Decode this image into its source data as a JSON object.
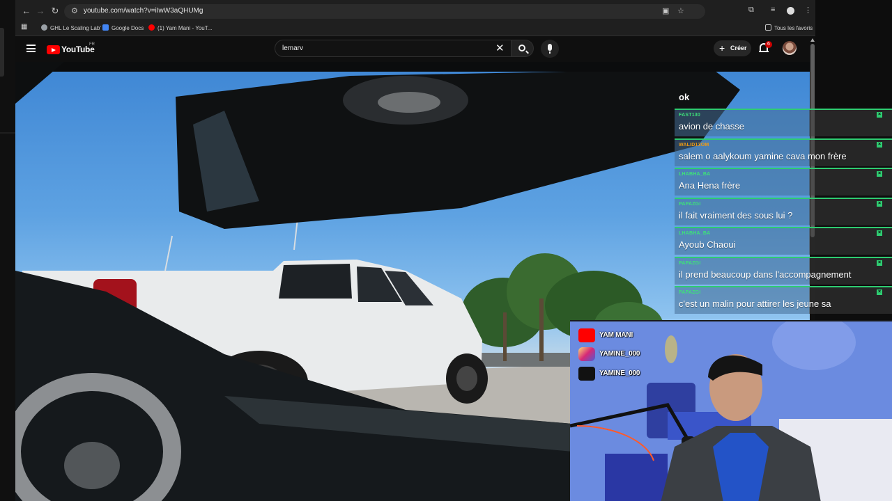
{
  "browser": {
    "url": "youtube.com/watch?v=iIwW3aQHUMg",
    "bookmarks": [
      {
        "label": "GHL Le Scaling Lab'",
        "icon": "globe-icon"
      },
      {
        "label": "Google Docs",
        "icon": "docs-icon"
      },
      {
        "label": "(1) Yam Mani - YouT...",
        "icon": "youtube-icon"
      }
    ],
    "bookmarks_folder": "Tous les favoris"
  },
  "youtube": {
    "logo_text": "YouTube",
    "region": "FR",
    "search_query": "lemarv",
    "create_label": "Créer",
    "notification_count": "6"
  },
  "chat": {
    "top_partial": "ok",
    "messages": [
      {
        "user": "FAST130",
        "text": "avion de chasse",
        "user_color": "#3ee07a"
      },
      {
        "user": "WALID13OM",
        "text": "salem o aalykoum yamine cava mon frère",
        "user_color": "#f39c12"
      },
      {
        "user": "LHABHA_BA",
        "text": "Ana Hena frère",
        "user_color": "#3ee07a"
      },
      {
        "user": "PAPAZGI",
        "text": "il fait vraiment des sous lui ?",
        "user_color": "#3ee07a"
      },
      {
        "user": "LHABHA_BA",
        "text": "Ayoub Chaoui",
        "user_color": "#3ee07a"
      },
      {
        "user": "PAPAZGI",
        "text": "il prend beaucoup dans l'accompagnement",
        "user_color": "#3ee07a"
      },
      {
        "user": "PAPAZGI",
        "text": "c'est un malin pour attirer les jeune sa",
        "user_color": "#3ee07a"
      }
    ]
  },
  "overlay": {
    "socials": [
      {
        "platform": "youtube-icon",
        "handle": "YAM MANI"
      },
      {
        "platform": "instagram-icon",
        "handle": "YAMINE_000"
      },
      {
        "platform": "tiktok-icon",
        "handle": "YAMINE_000"
      }
    ]
  },
  "colors": {
    "youtube_red": "#ff0000",
    "chat_accent": "#2ecc71",
    "header_bg": "#0f0f0f"
  }
}
